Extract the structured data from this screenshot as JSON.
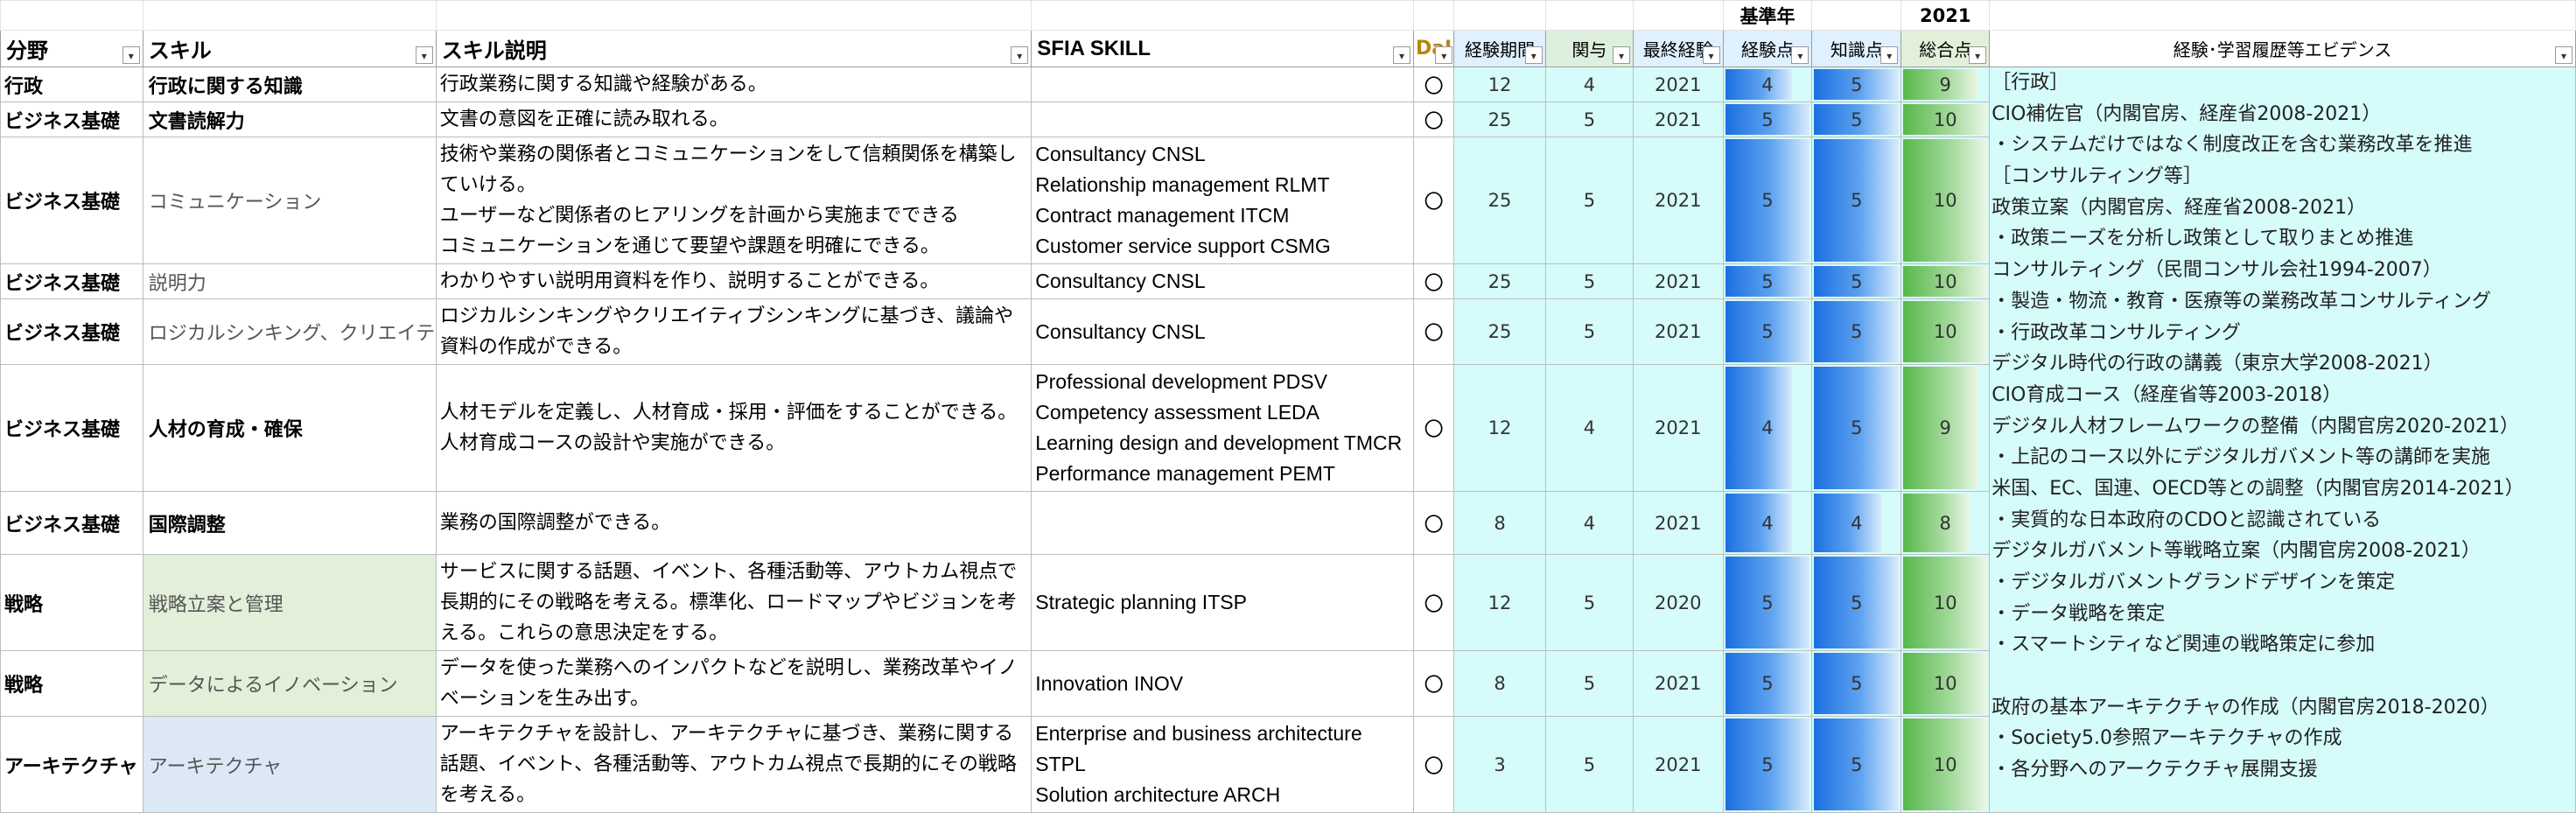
{
  "top": {
    "base_year_label": "基準年",
    "base_year_value": "2021"
  },
  "headers": {
    "category": "分野",
    "skill": "スキル",
    "skill_desc": "スキル説明",
    "sfia": "SFIA SKILL",
    "dai": "DaI",
    "exp_years": "経験期間",
    "involvement": "関与",
    "last_year": "最終経験",
    "exp_points": "経験点",
    "knowledge_points": "知識点",
    "total_points": "総合点",
    "evidence": "経験･学習履歴等エビデンス"
  },
  "rows": [
    {
      "category": "行政",
      "skill": "行政に関する知識",
      "skill_style": "bold",
      "desc": [
        "行政業務に関する知識や経験がある。"
      ],
      "sfia": [],
      "dai": "〇",
      "exp_years": "12",
      "involvement": "4",
      "last_year": "2021",
      "exp_points": "4",
      "knowledge_points": "5",
      "total_points": "9"
    },
    {
      "category": "ビジネス基礎",
      "skill": "文書読解力",
      "skill_style": "bold",
      "desc": [
        "文書の意図を正確に読み取れる。"
      ],
      "sfia": [],
      "dai": "〇",
      "exp_years": "25",
      "involvement": "5",
      "last_year": "2021",
      "exp_points": "5",
      "knowledge_points": "5",
      "total_points": "10"
    },
    {
      "category": "ビジネス基礎",
      "skill": "コミュニケーション",
      "skill_style": "gray",
      "desc": [
        "技術や業務の関係者とコミュニケーションをして信頼関係を構築し",
        "ていける。",
        "ユーザーなど関係者のヒアリングを計画から実施までできる",
        "コミュニケーションを通じて要望や課題を明確にできる。"
      ],
      "sfia": [
        "Consultancy CNSL",
        "Relationship management RLMT",
        "Contract management ITCM",
        "Customer service support CSMG"
      ],
      "dai": "〇",
      "exp_years": "25",
      "involvement": "5",
      "last_year": "2021",
      "exp_points": "5",
      "knowledge_points": "5",
      "total_points": "10"
    },
    {
      "category": "ビジネス基礎",
      "skill": "説明力",
      "skill_style": "gray",
      "desc": [
        "わかりやすい説明用資料を作り、説明することができる。"
      ],
      "sfia": [
        "Consultancy CNSL"
      ],
      "dai": "〇",
      "exp_years": "25",
      "involvement": "5",
      "last_year": "2021",
      "exp_points": "5",
      "knowledge_points": "5",
      "total_points": "10"
    },
    {
      "category": "ビジネス基礎",
      "skill": "ロジカルシンキング、クリエイテ",
      "skill_style": "gray",
      "desc": [
        "ロジカルシンキングやクリエイティブシンキングに基づき、議論や",
        "資料の作成ができる。"
      ],
      "sfia": [
        "Consultancy CNSL"
      ],
      "dai": "〇",
      "exp_years": "25",
      "involvement": "5",
      "last_year": "2021",
      "exp_points": "5",
      "knowledge_points": "5",
      "total_points": "10"
    },
    {
      "category": "ビジネス基礎",
      "skill": "人材の育成・確保",
      "skill_style": "bold",
      "desc": [
        "人材モデルを定義し、人材育成・採用・評価をすることができる。",
        "人材育成コースの設計や実施ができる。"
      ],
      "sfia": [
        "Professional development PDSV",
        "Competency assessment LEDA",
        "Learning design and development TMCR",
        "Performance management PEMT"
      ],
      "dai": "〇",
      "exp_years": "12",
      "involvement": "4",
      "last_year": "2021",
      "exp_points": "4",
      "knowledge_points": "5",
      "total_points": "9"
    },
    {
      "category": "ビジネス基礎",
      "skill": "国際調整",
      "skill_style": "bold",
      "desc": [
        "業務の国際調整ができる。"
      ],
      "sfia": [],
      "dai": "〇",
      "exp_years": "8",
      "involvement": "4",
      "last_year": "2021",
      "exp_points": "4",
      "knowledge_points": "4",
      "total_points": "8"
    },
    {
      "category": "戦略",
      "skill": "戦略立案と管理",
      "skill_style": "gray-green",
      "desc": [
        "サービスに関する話題、イベント、各種活動等、アウトカム視点で",
        "長期的にその戦略を考える。標準化、ロードマップやビジョンを考",
        "える。これらの意思決定をする。"
      ],
      "sfia": [
        "Strategic planning ITSP"
      ],
      "dai": "〇",
      "exp_years": "12",
      "involvement": "5",
      "last_year": "2020",
      "exp_points": "5",
      "knowledge_points": "5",
      "total_points": "10"
    },
    {
      "category": "戦略",
      "skill": "データによるイノベーション",
      "skill_style": "gray-green",
      "desc": [
        "データを使った業務へのインパクトなどを説明し、業務改革やイノ",
        "ベーションを生み出す。"
      ],
      "sfia": [
        "Innovation INOV"
      ],
      "dai": "〇",
      "exp_years": "8",
      "involvement": "5",
      "last_year": "2021",
      "exp_points": "5",
      "knowledge_points": "5",
      "total_points": "10"
    },
    {
      "category": "アーキテクチャ",
      "skill": "アーキテクチャ",
      "skill_style": "gray-blue",
      "desc": [
        "アーキテクチャを設計し、アーキテクチャに基づき、業務に関する",
        "話題、イベント、各種活動等、アウトカム視点で長期的にその戦略",
        "を考える。"
      ],
      "sfia": [
        "Enterprise and business architecture",
        "STPL",
        "Solution architecture ARCH"
      ],
      "dai": "〇",
      "exp_years": "3",
      "involvement": "5",
      "last_year": "2021",
      "exp_points": "5",
      "knowledge_points": "5",
      "total_points": "10"
    }
  ],
  "evidence_lines": [
    "［行政］",
    "CIO補佐官（内閣官房、経産省2008-2021）",
    "・システムだけではなく制度改正を含む業務改革を推進",
    "［コンサルティング等］",
    "政策立案（内閣官房、経産省2008-2021）",
    "・政策ニーズを分析し政策として取りまとめ推進",
    "コンサルティング（民間コンサル会社1994-2007）",
    "・製造・物流・教育・医療等の業務改革コンサルティング",
    "・行政改革コンサルティング",
    "デジタル時代の行政の講義（東京大学2008-2021）",
    "CIO育成コース（経産省等2003-2018）",
    "デジタル人材フレームワークの整備（内閣官房2020-2021）",
    "・上記のコース以外にデジタルガバメント等の講師を実施",
    "米国、EC、国連、OECD等との調整（内閣官房2014-2021）",
    "・実質的な日本政府のCDOと認識されている",
    "デジタルガバメント等戦略立案（内閣官房2008-2021）",
    "・デジタルガバメントグランドデザインを策定",
    "・データ戦略を策定",
    "・スマートシティなど関連の戦略策定に参加",
    "",
    "政府の基本アーキテクチャの作成（内閣官房2018-2020）",
    "・Society5.0参照アーキテクチャの作成",
    "・各分野へのアークテクチャ展開支援"
  ],
  "bar_scale_max": 5,
  "total_scale_max": 10
}
